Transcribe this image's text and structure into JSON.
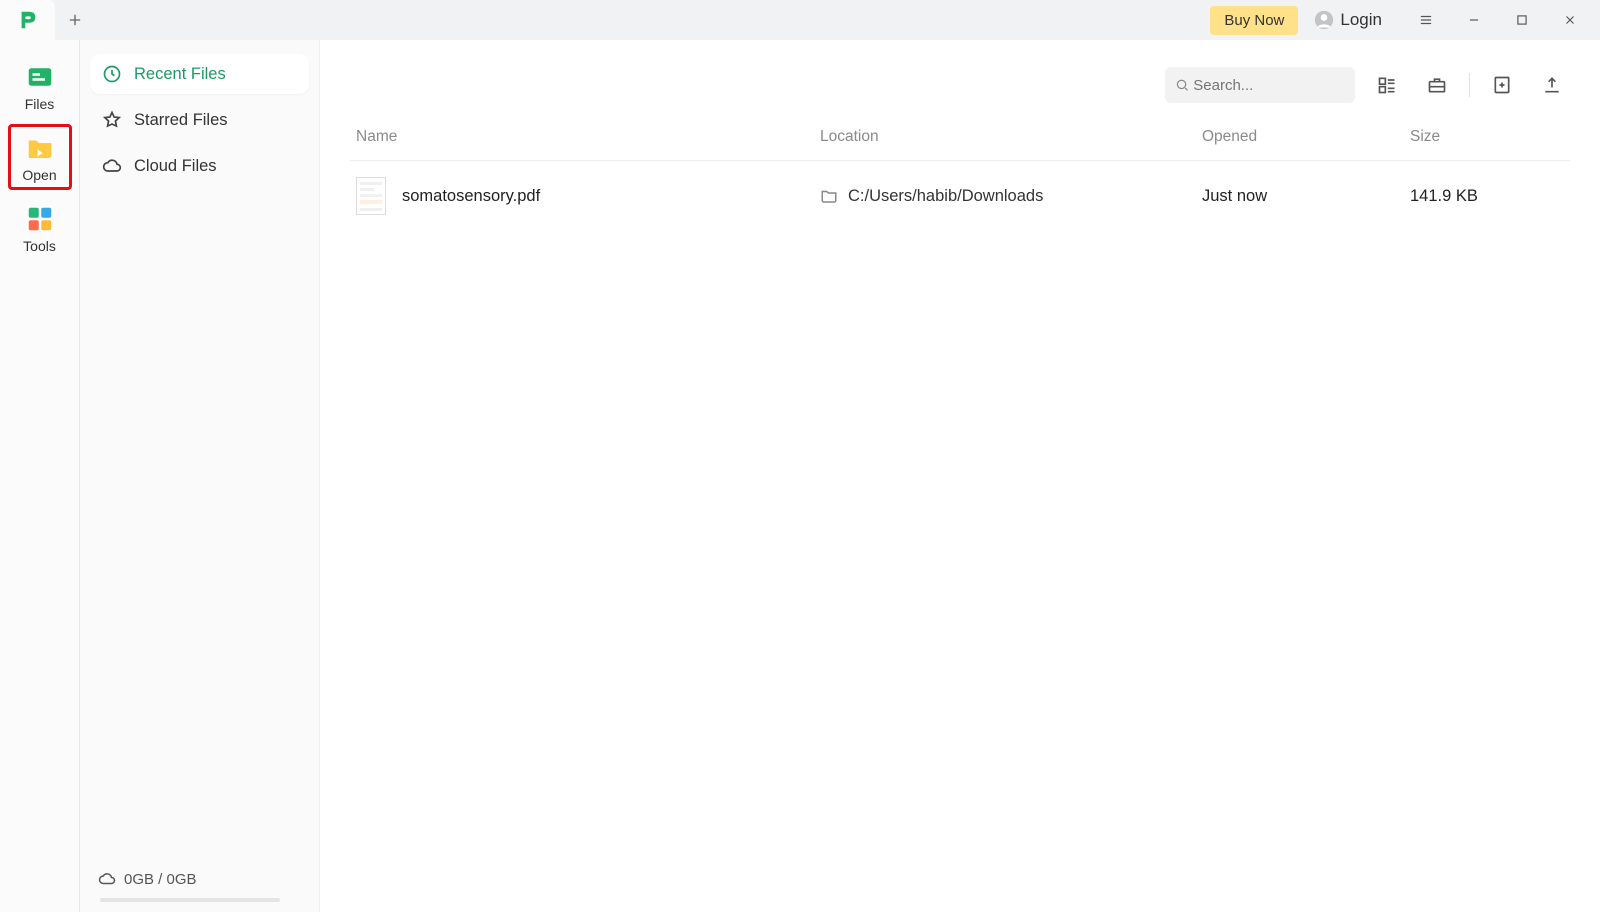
{
  "titlebar": {
    "buy_now": "Buy Now",
    "login": "Login"
  },
  "leftnav": {
    "items": [
      {
        "label": "Files"
      },
      {
        "label": "Open"
      },
      {
        "label": "Tools"
      }
    ]
  },
  "sidebar": {
    "items": [
      {
        "label": "Recent Files"
      },
      {
        "label": "Starred Files"
      },
      {
        "label": "Cloud Files"
      }
    ],
    "storage_text": "0GB / 0GB"
  },
  "toolbar": {
    "search_placeholder": "Search..."
  },
  "table": {
    "headers": {
      "name": "Name",
      "location": "Location",
      "opened": "Opened",
      "size": "Size"
    },
    "rows": [
      {
        "name": "somatosensory.pdf",
        "location": "C:/Users/habib/Downloads",
        "opened": "Just now",
        "size": "141.9 KB"
      }
    ]
  }
}
